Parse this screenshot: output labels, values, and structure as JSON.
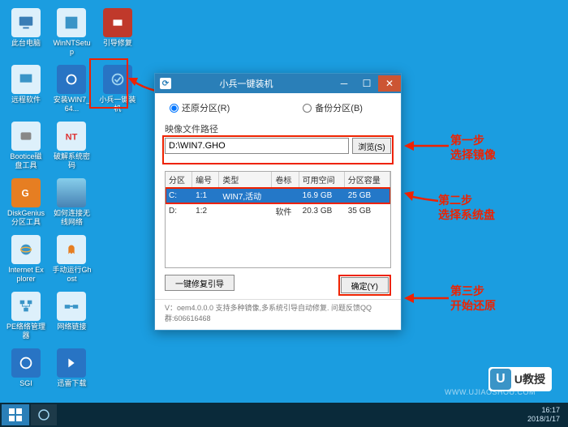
{
  "desktop_icons": [
    [
      {
        "name": "此台电脑",
        "icon": "pc"
      },
      {
        "name": "WinNTSetup",
        "icon": "app"
      },
      {
        "name": "引导修复",
        "icon": "toolbox"
      }
    ],
    [
      {
        "name": "远程软件",
        "icon": "remote"
      },
      {
        "name": "安装WIN7_64...",
        "icon": "gear"
      },
      {
        "name": "小兵一键装机",
        "icon": "installer",
        "highlighted": true
      }
    ],
    [
      {
        "name": "Bootice磁盘工具",
        "icon": "disk"
      },
      {
        "name": "破解系统密码",
        "icon": "nt"
      }
    ],
    [
      {
        "name": "DiskGenius分区工具",
        "icon": "dg"
      },
      {
        "name": "如何连接无线网络",
        "icon": "wifi"
      }
    ],
    [
      {
        "name": "Internet Explorer",
        "icon": "ie"
      },
      {
        "name": "手动运行Ghost",
        "icon": "ghost"
      }
    ],
    [
      {
        "name": "PE络络管理器",
        "icon": "net"
      },
      {
        "name": "网络链接",
        "icon": "netlink"
      }
    ],
    [
      {
        "name": "SGI",
        "icon": "sgi"
      },
      {
        "name": "迅雷下载",
        "icon": "xunlei"
      }
    ]
  ],
  "window": {
    "title": "小兵一键装机",
    "radio_restore": "还原分区(R)",
    "radio_backup": "备份分区(B)",
    "image_path_label": "映像文件路径",
    "image_path_value": "D:\\WIN7.GHO",
    "browse_btn": "浏览(S)",
    "table": {
      "headers": [
        "分区",
        "编号",
        "类型",
        "卷标",
        "可用空间",
        "分区容量"
      ],
      "rows": [
        {
          "cells": [
            "C:",
            "1:1",
            "WIN7,活动",
            "",
            "16.9 GB",
            "25 GB"
          ],
          "selected": true
        },
        {
          "cells": [
            "D:",
            "1:2",
            "",
            "软件",
            "20.3 GB",
            "35 GB"
          ],
          "selected": false
        }
      ]
    },
    "repair_btn": "一键修复引导",
    "ok_btn": "确定(Y)",
    "status": "V：oem4.0.0.0      支持多种镜像,多系统引导自动修复. 问题反馈QQ群:606616468"
  },
  "annotations": {
    "step1_title": "第一步",
    "step1_sub": "选择镜像",
    "step2_title": "第二步",
    "step2_sub": "选择系统盘",
    "step3_title": "第三步",
    "step3_sub": "开始还原"
  },
  "taskbar": {
    "time": "16:17",
    "date": "2018/1/17"
  },
  "watermark": {
    "url": "WWW.UJIAOSHOU.COM",
    "badge_text": "U教授"
  }
}
